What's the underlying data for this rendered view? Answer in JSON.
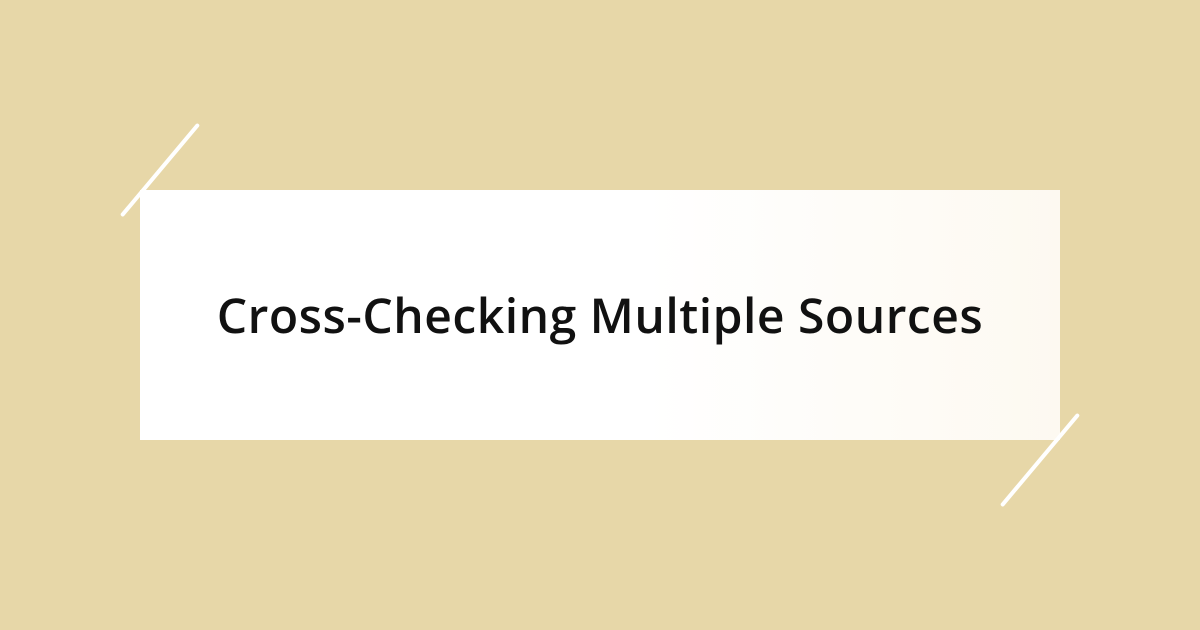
{
  "card": {
    "title": "Cross-Checking Multiple Sources"
  },
  "colors": {
    "background": "#e7d7a8",
    "card": "#ffffff",
    "accent": "#ffffff",
    "text": "#111111"
  }
}
